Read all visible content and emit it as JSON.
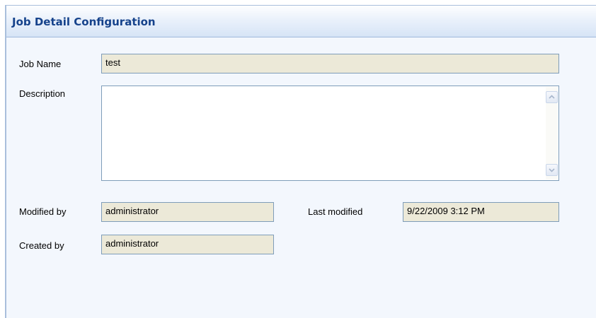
{
  "header": {
    "title": "Job Detail Configuration"
  },
  "form": {
    "job_name": {
      "label": "Job Name",
      "value": "test"
    },
    "description": {
      "label": "Description",
      "value": ""
    },
    "modified_by": {
      "label": "Modified by",
      "value": "administrator"
    },
    "last_modified": {
      "label": "Last modified",
      "value": "9/22/2009 3:12 PM"
    },
    "created_by": {
      "label": "Created by",
      "value": "administrator"
    }
  },
  "icons": {
    "scroll_up": "chevron-up-icon",
    "scroll_down": "chevron-down-icon"
  },
  "colors": {
    "header_text": "#15428b",
    "panel_background": "#f3f7fd",
    "readonly_field": "#ece9d8",
    "field_border": "#7f9db9"
  }
}
